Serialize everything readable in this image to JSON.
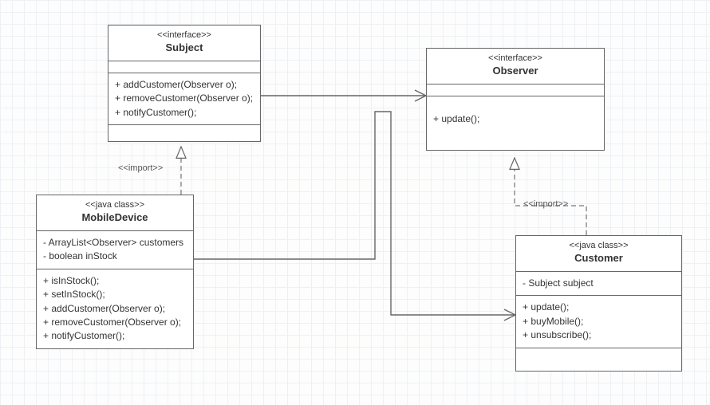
{
  "diagram": {
    "type": "uml-class",
    "nodes": {
      "subject": {
        "stereotype": "<<interface>>",
        "name": "Subject",
        "attributes": [],
        "operations": [
          "+ addCustomer(Observer o);",
          "+ removeCustomer(Observer o);",
          "+ notifyCustomer();"
        ]
      },
      "observer": {
        "stereotype": "<<interface>>",
        "name": "Observer",
        "attributes": [],
        "operations": [
          "+ update();"
        ]
      },
      "mobileDevice": {
        "stereotype": "<<java class>>",
        "name": "MobileDevice",
        "attributes": [
          "- ArrayList<Observer> customers",
          "- boolean inStock"
        ],
        "operations": [
          "+ isInStock();",
          "+ setInStock();",
          "+ addCustomer(Observer o);",
          "+ removeCustomer(Observer o);",
          "+ notifyCustomer();"
        ]
      },
      "customer": {
        "stereotype": "<<java class>>",
        "name": "Customer",
        "attributes": [
          "- Subject subject"
        ],
        "operations": [
          "+ update();",
          "+ buyMobile();",
          "+ unsubscribe();"
        ]
      }
    },
    "edges": {
      "mobile_to_subject": {
        "label": "<<import>>",
        "style": "realization"
      },
      "customer_to_observer": {
        "label": "<<import>>",
        "style": "realization"
      },
      "subject_to_observer": {
        "style": "association"
      },
      "mobile_to_customer": {
        "style": "association"
      }
    }
  }
}
